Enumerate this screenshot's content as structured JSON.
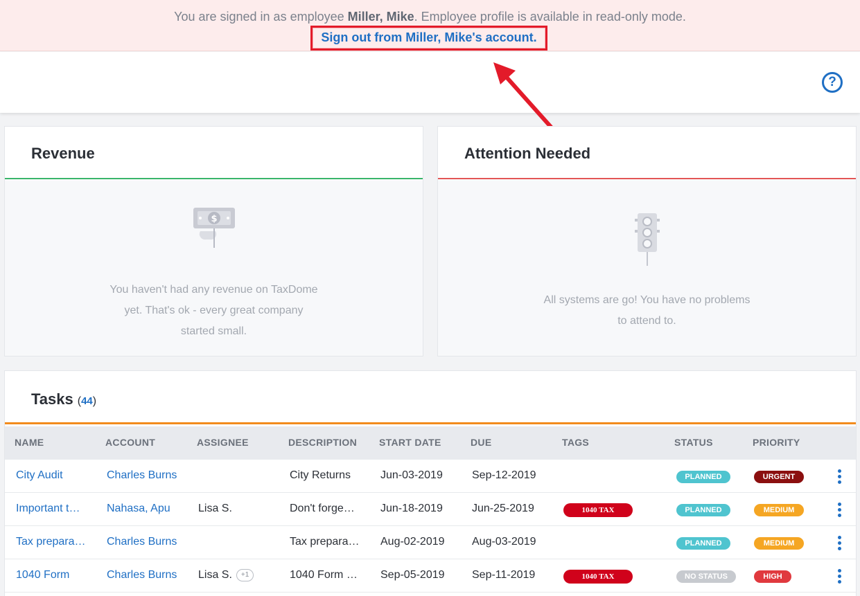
{
  "banner": {
    "prefix": "You are signed in as employee ",
    "employee": "Miller, Mike",
    "suffix": ". Employee profile is available in read-only mode.",
    "signout": "Sign out from Miller, Mike's account."
  },
  "help": "?",
  "revenue": {
    "title": "Revenue",
    "empty_line1": "You haven't had any revenue on TaxDome",
    "empty_line2": "yet. That's ok - every great company",
    "empty_line3": "started small."
  },
  "attention": {
    "title": "Attention Needed",
    "empty_line1": "All systems are go! You have no problems",
    "empty_line2": "to attend to."
  },
  "tasks": {
    "title": "Tasks",
    "count_open": "(",
    "count": "44",
    "count_close": ")",
    "columns": [
      "NAME",
      "ACCOUNT",
      "ASSIGNEE",
      "DESCRIPTION",
      "START DATE",
      "DUE",
      "TAGS",
      "STATUS",
      "PRIORITY"
    ],
    "rows": [
      {
        "name": "City Audit",
        "account": "Charles Burns",
        "assignee": "",
        "extra": "",
        "description": "City Returns",
        "start": "Jun-03-2019",
        "due": "Sep-12-2019",
        "tag": "",
        "status": "PLANNED",
        "priority": "URGENT"
      },
      {
        "name": "Important t…",
        "account": "Nahasa, Apu",
        "assignee": "Lisa S.",
        "extra": "",
        "description": "Don't forge…",
        "start": "Jun-18-2019",
        "due": "Jun-25-2019",
        "tag": "1040 TAX",
        "status": "PLANNED",
        "priority": "MEDIUM"
      },
      {
        "name": "Tax prepara…",
        "account": "Charles Burns",
        "assignee": "",
        "extra": "",
        "description": "Tax prepara…",
        "start": "Aug-02-2019",
        "due": "Aug-03-2019",
        "tag": "",
        "status": "PLANNED",
        "priority": "MEDIUM"
      },
      {
        "name": "1040 Form",
        "account": "Charles Burns",
        "assignee": "Lisa S.",
        "extra": "+1",
        "description": "1040 Form …",
        "start": "Sep-05-2019",
        "due": "Sep-11-2019",
        "tag": "1040 TAX",
        "status": "NO STATUS",
        "priority": "HIGH"
      }
    ]
  },
  "colors": {
    "planned": "#4fc4cf",
    "no_status": "#c7cacf",
    "urgent": "#8b0f0f",
    "medium": "#f5a623",
    "high": "#e0393e",
    "tag": "#d0021b"
  }
}
